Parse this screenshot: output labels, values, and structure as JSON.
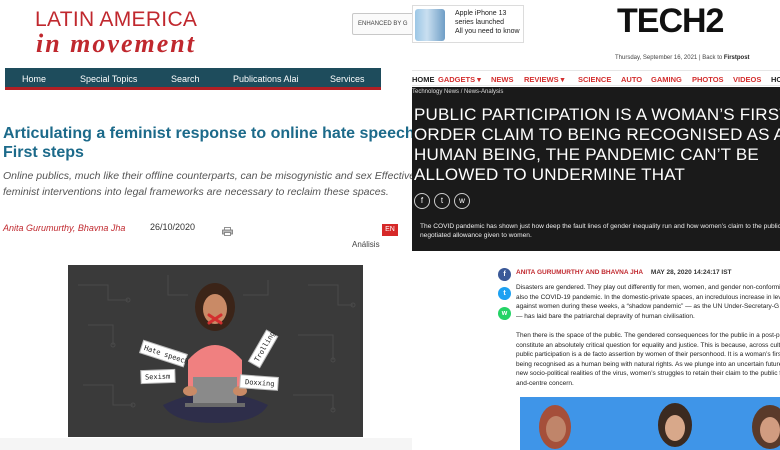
{
  "left": {
    "logo": {
      "line1": "LATIN AMERICA",
      "line2": "in movement"
    },
    "enhanced_label": "ENHANCED BY G",
    "nav": [
      "Home",
      "Special Topics",
      "Search",
      "Publications Alai",
      "Services"
    ],
    "article": {
      "title": "Articulating a feminist response to online hate speech: First steps",
      "subtitle": "Online publics, much like their offline counterparts, can be misogynistic and sex Effective feminist interventions into legal frameworks are necessary to reclaim these spaces.",
      "authors": "Anita Gurumurthy, Bhavna Jha",
      "date": "26/10/2020",
      "lang_badge": "EN",
      "section": "Análisis"
    },
    "illustration_tags": [
      "Hate speech",
      "Trolling",
      "Sexism",
      "Doxxing"
    ]
  },
  "right": {
    "ad": {
      "line1": "Apple iPhone 13",
      "line2": "series launched",
      "line3": "All you need to know"
    },
    "logo": "TECH2",
    "tagline_date": "Thursday, September 16, 2021",
    "tagline_back": "Back to",
    "tagline_site": "Firstpost",
    "nav": [
      "HOME",
      "GADGETS ▾",
      "NEWS",
      "REVIEWS ▾",
      "SCIENCE",
      "AUTO",
      "GAMING",
      "PHOTOS",
      "VIDEOS",
      "HOW"
    ],
    "breadcrumb": "Technology News / News-Analysis",
    "headline": "PUBLIC PARTICIPATION IS A WOMAN’S FIRST-ORDER CLAIM TO BEING RECOGNISED AS A HUMAN BEING, THE PANDEMIC CAN’T BE ALLOWED TO UNDERMINE THAT",
    "summary": "The COVID pandemic has shown just how deep the fault lines of gender inequality run and how women’s claim to the public carefully negotiated allowance given to women.",
    "authors": "ANITA GURUMURTHY AND BHAVNA JHA",
    "date": "MAY 28, 2020 14:24:17 IST",
    "para1": "Disasters are gendered. They play out differently for men, women, and gender non-conforming also the COVID-19 pandemic. In the domestic-private spaces, an incredulous increase in level against women during these weeks, a “shadow pandemic” — as the UN Under-Secretary-G to it — has laid bare the patriarchal depravity of human civilisation.",
    "para2": "Then there is the space of the public. The gendered consequences for the public in a post-pa constitute an absolutely critical question for equality and justice. This is because, across cult public participation is a de facto assertion by women of their personhood. It is a woman’s first being recognised as a human being with natural rights. As we plunge into an uncertain future new socio-political realities of the virus, women’s struggles to retain their claim to the public front-and-centre concern."
  },
  "colors": {
    "lam_red": "#c0282e",
    "lam_nav": "#1e4c5c",
    "title_blue": "#1c6a8a",
    "tech2_dark": "#1a1a1a",
    "facebook": "#3b5998",
    "twitter": "#1da1f2",
    "whatsapp": "#25d366"
  }
}
